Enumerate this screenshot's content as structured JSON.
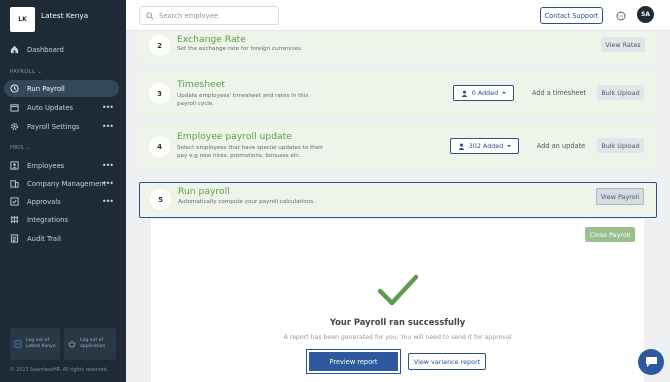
{
  "brand": {
    "logo_text": "LK",
    "name": "Latest Kenya"
  },
  "sidebar": {
    "dashboard": "Dashboard",
    "payroll_section": "PAYROLL",
    "payroll_items": [
      {
        "label": "Run Payroll",
        "icon": "clock-icon",
        "active": true
      },
      {
        "label": "Auto Updates",
        "icon": "calendar-icon"
      },
      {
        "label": "Payroll Settings",
        "icon": "gear-icon"
      }
    ],
    "hris_section": "HRIS",
    "hris_items": [
      {
        "label": "Employees",
        "icon": "employees-icon"
      },
      {
        "label": "Company Management",
        "icon": "building-icon"
      },
      {
        "label": "Approvals",
        "icon": "approvals-icon"
      },
      {
        "label": "Integrations",
        "icon": "integrations-icon"
      },
      {
        "label": "Audit Trail",
        "icon": "audit-icon"
      }
    ],
    "logout_latest": "Log out of Latest Kenya",
    "logout_app": "Log out of application",
    "copyright": "© 2023 SeamlessHR. All rights reserved."
  },
  "topbar": {
    "search_placeholder": "Search employee",
    "contact_label": "Contact Support",
    "avatar_initials": "SA"
  },
  "steps": [
    {
      "num": "2",
      "title": "Exchange Rate",
      "desc": "Set the exchange rate for foreign currencies.",
      "action": "View Rates"
    },
    {
      "num": "3",
      "title": "Timesheet",
      "desc": "Update employees' timesheet and rates in this payroll cycle.",
      "added": "0 Added",
      "link": "Add a timesheet",
      "bulk": "Bulk Upload"
    },
    {
      "num": "4",
      "title": "Employee payroll update",
      "desc": "Select employees that have special updates to their pay e.g new hires, promotions, bonuses etc.",
      "added": "302 Added",
      "link": "Add an update",
      "bulk": "Bulk Upload"
    },
    {
      "num": "5",
      "title": "Run payroll",
      "desc": "Automatically compute your payroll calculations.",
      "action": "View Payroll"
    }
  ],
  "result": {
    "close_label": "Close Payroll",
    "title": "Your Payroll ran successfully",
    "desc": "A report has been generated for you. You will need to send it for approval",
    "preview_label": "Preview report",
    "variance_label": "View variance report"
  },
  "colors": {
    "accent": "#2d4f8a",
    "success": "#5e9c4c",
    "sidebar": "#1e2a35"
  }
}
